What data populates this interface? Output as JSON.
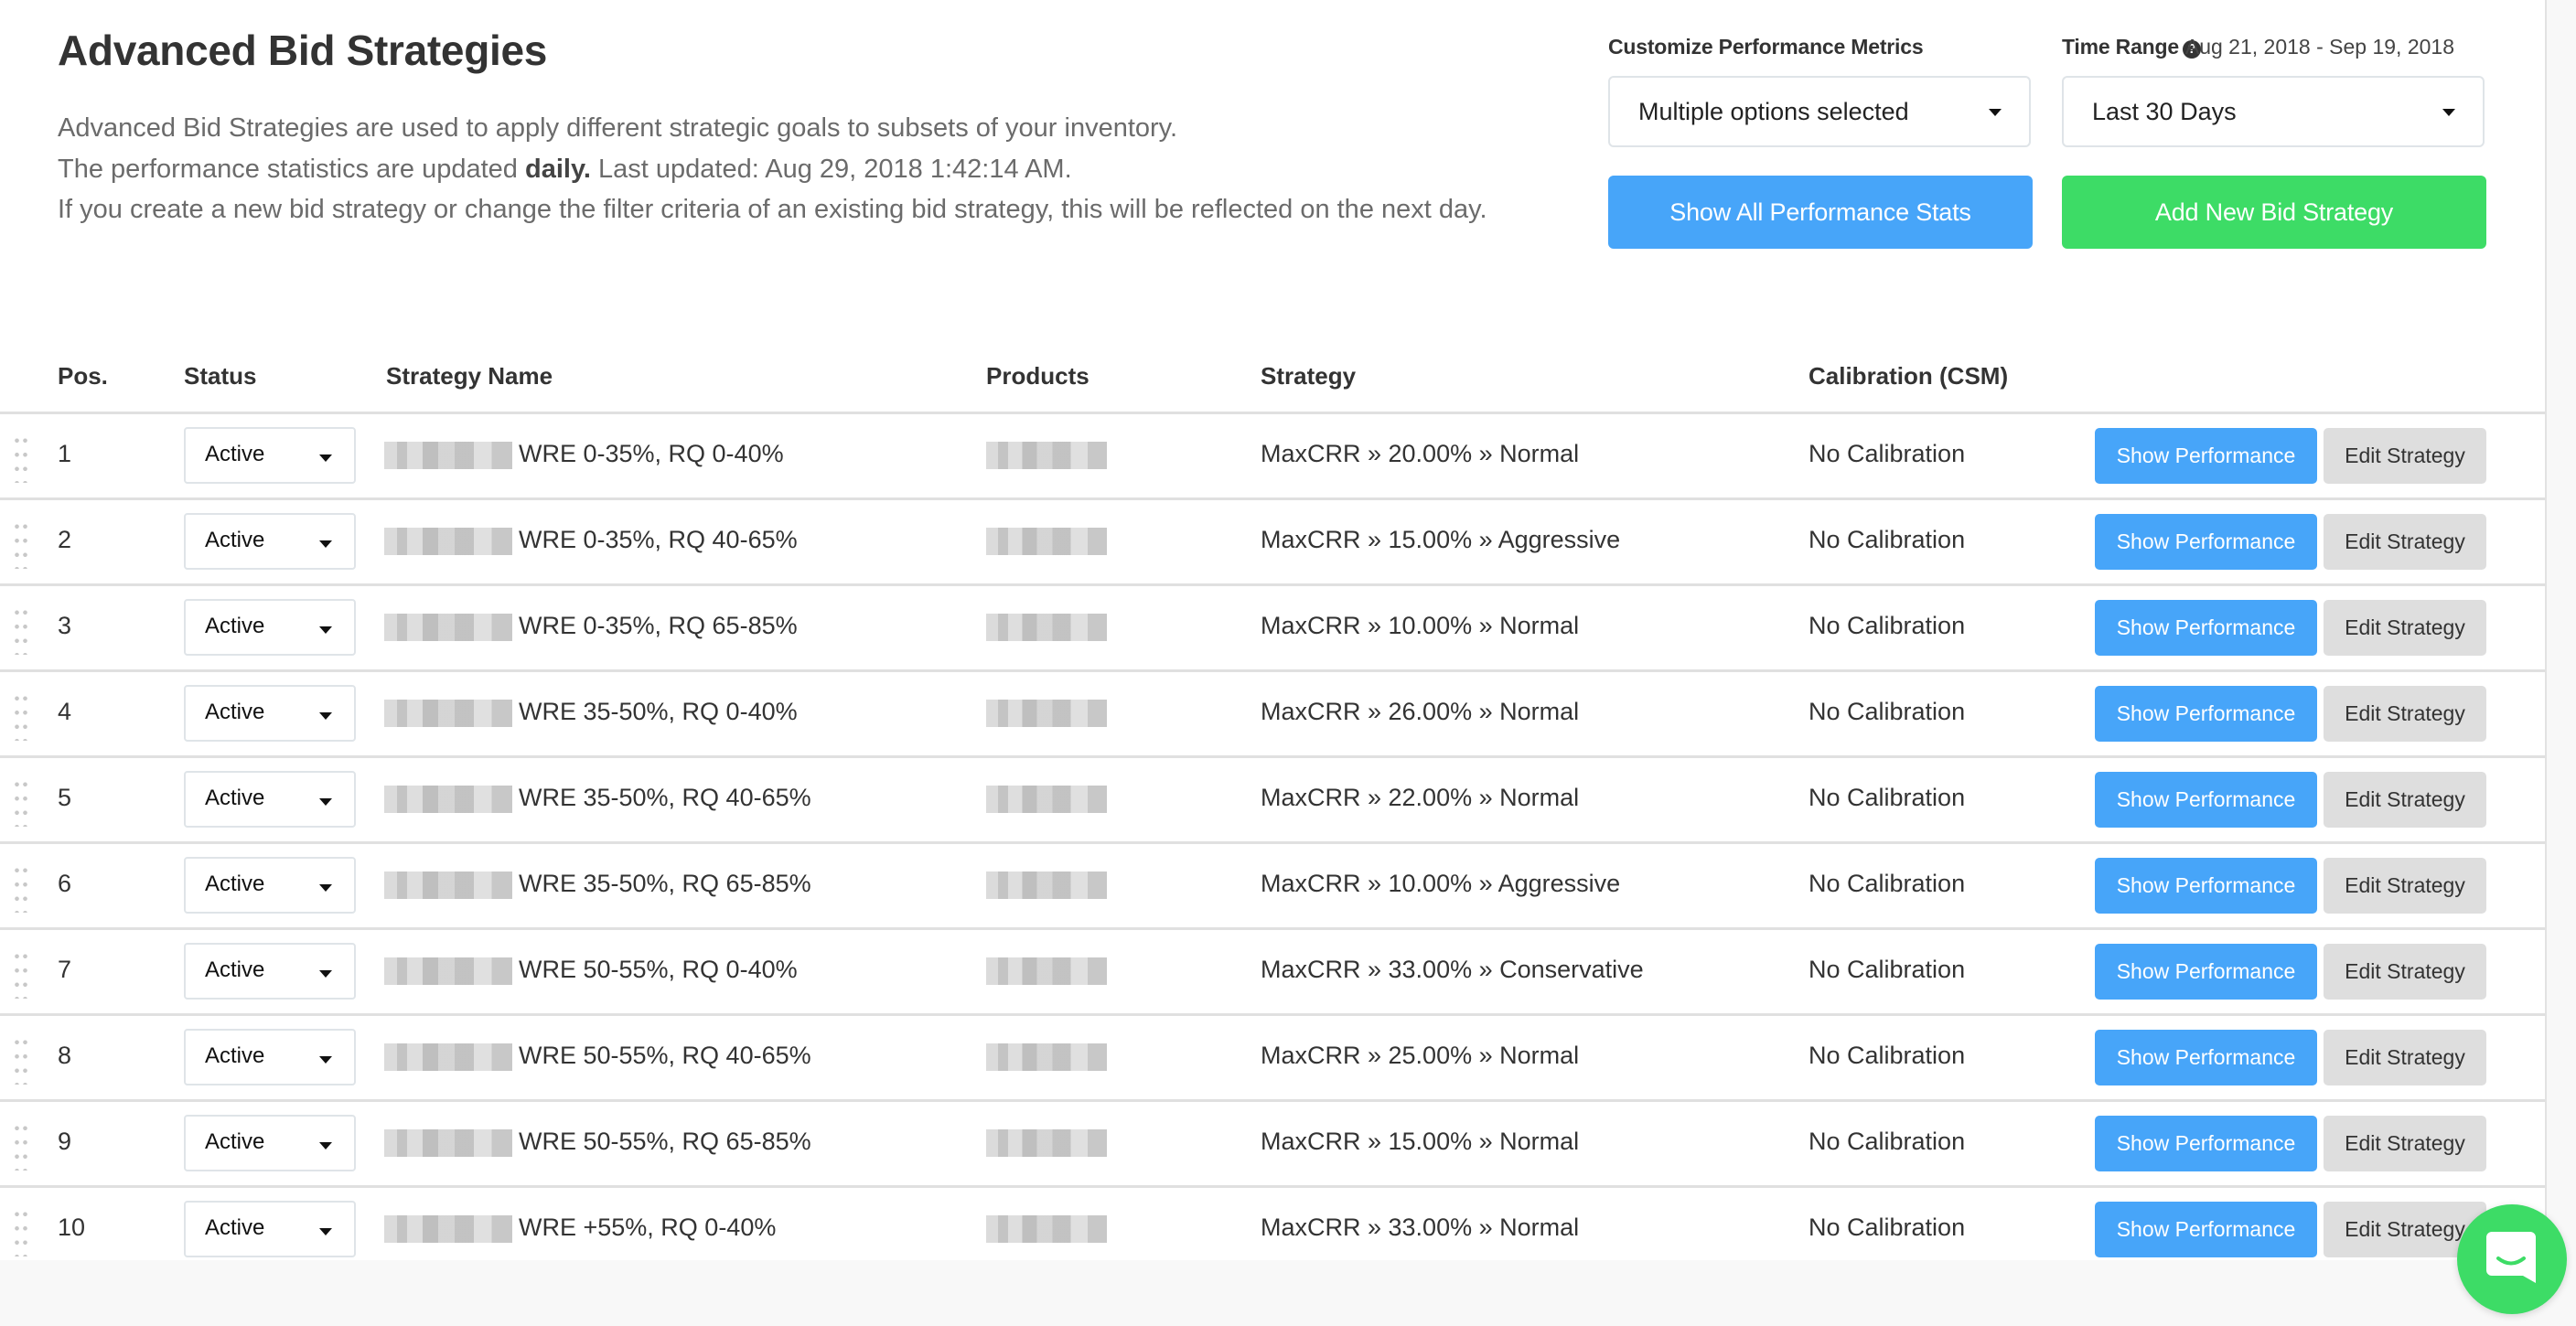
{
  "header": {
    "title": "Advanced Bid Strategies",
    "description": {
      "line1": "Advanced Bid Strategies are used to apply different strategic goals to subsets of your inventory.",
      "line2_prefix": "The performance statistics are updated ",
      "line2_bold": "daily.",
      "line2_suffix": " Last updated: Aug 29, 2018 1:42:14 AM.",
      "line3": "If you create a new bid strategy or change the filter criteria of an existing bid strategy, this will be reflected on the next day."
    }
  },
  "controls": {
    "metrics_label": "Customize Performance Metrics",
    "metrics_value": "Multiple options selected",
    "time_range_label": "Time Range",
    "help_icon_glyph": "?",
    "date_range": "Aug 21, 2018 - Sep 19, 2018",
    "time_range_value": "Last 30 Days",
    "show_all_stats_label": "Show All Performance Stats",
    "add_strategy_label": "Add New Bid Strategy"
  },
  "colors": {
    "primary_blue": "#47a5f9",
    "success_green": "#3ddc66",
    "secondary_gray": "#dedede"
  },
  "table": {
    "columns": [
      "Pos.",
      "Status",
      "Strategy Name",
      "Products",
      "Strategy",
      "Calibration (CSM)"
    ],
    "row_action_labels": {
      "show_performance": "Show Performance",
      "edit_strategy": "Edit Strategy"
    },
    "rows": [
      {
        "pos": "1",
        "status": "Active",
        "name": "WRE 0-35%, RQ 0-40%",
        "strategy": "MaxCRR » 20.00% » Normal",
        "calibration": "No Calibration"
      },
      {
        "pos": "2",
        "status": "Active",
        "name": "WRE 0-35%, RQ 40-65%",
        "strategy": "MaxCRR » 15.00% » Aggressive",
        "calibration": "No Calibration"
      },
      {
        "pos": "3",
        "status": "Active",
        "name": "WRE 0-35%, RQ 65-85%",
        "strategy": "MaxCRR » 10.00% » Normal",
        "calibration": "No Calibration"
      },
      {
        "pos": "4",
        "status": "Active",
        "name": "WRE 35-50%, RQ 0-40%",
        "strategy": "MaxCRR » 26.00% » Normal",
        "calibration": "No Calibration"
      },
      {
        "pos": "5",
        "status": "Active",
        "name": "WRE 35-50%, RQ 40-65%",
        "strategy": "MaxCRR » 22.00% » Normal",
        "calibration": "No Calibration"
      },
      {
        "pos": "6",
        "status": "Active",
        "name": "WRE 35-50%, RQ 65-85%",
        "strategy": "MaxCRR » 10.00% » Aggressive",
        "calibration": "No Calibration"
      },
      {
        "pos": "7",
        "status": "Active",
        "name": "WRE 50-55%, RQ 0-40%",
        "strategy": "MaxCRR » 33.00% » Conservative",
        "calibration": "No Calibration"
      },
      {
        "pos": "8",
        "status": "Active",
        "name": "WRE 50-55%, RQ 40-65%",
        "strategy": "MaxCRR » 25.00% » Normal",
        "calibration": "No Calibration"
      },
      {
        "pos": "9",
        "status": "Active",
        "name": "WRE 50-55%, RQ 65-85%",
        "strategy": "MaxCRR » 15.00% » Normal",
        "calibration": "No Calibration"
      },
      {
        "pos": "10",
        "status": "Active",
        "name": "WRE +55%, RQ 0-40%",
        "strategy": "MaxCRR » 33.00% » Normal",
        "calibration": "No Calibration"
      }
    ]
  },
  "chat_widget": {
    "icon": "chat-bubble-icon"
  }
}
